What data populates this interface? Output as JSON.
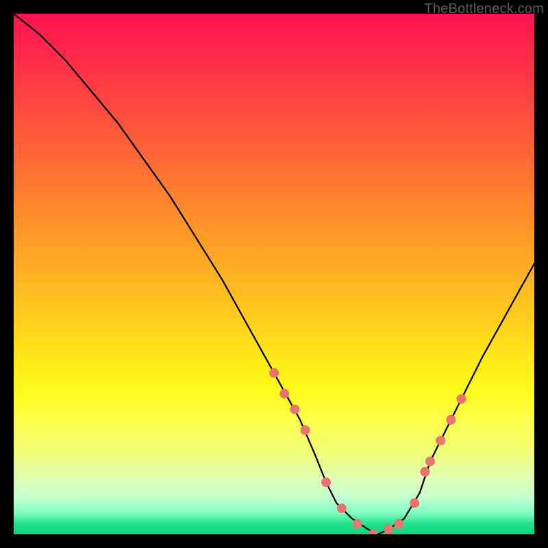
{
  "watermark": "TheBottleneck.com",
  "chart_data": {
    "type": "line",
    "title": "",
    "xlabel": "",
    "ylabel": "",
    "xlim": [
      0,
      100
    ],
    "ylim": [
      0,
      100
    ],
    "series": [
      {
        "name": "bottleneck-curve",
        "x": [
          0,
          5,
          10,
          15,
          20,
          25,
          30,
          35,
          40,
          45,
          50,
          55,
          58,
          60,
          62,
          65,
          68,
          70,
          72,
          75,
          78,
          80,
          85,
          90,
          95,
          100
        ],
        "values": [
          100,
          96,
          91,
          85,
          79,
          72,
          65,
          57,
          49,
          40,
          31,
          22,
          15,
          10,
          6,
          3,
          1,
          0,
          1,
          3,
          8,
          14,
          24,
          34,
          43,
          52
        ]
      }
    ],
    "markers": {
      "name": "highlight-dots",
      "x": [
        50,
        52,
        54,
        56,
        60,
        63,
        66,
        69,
        72,
        74,
        77,
        79,
        80,
        82,
        84,
        86
      ],
      "values": [
        31,
        27,
        24,
        20,
        10,
        5,
        2,
        0,
        1,
        2,
        6,
        12,
        14,
        18,
        22,
        26
      ]
    },
    "colors": {
      "curve": "#000000",
      "marker": "#e9746f",
      "gradient_top": "#ff1450",
      "gradient_mid": "#ffe81a",
      "gradient_bottom": "#0fd480"
    }
  }
}
